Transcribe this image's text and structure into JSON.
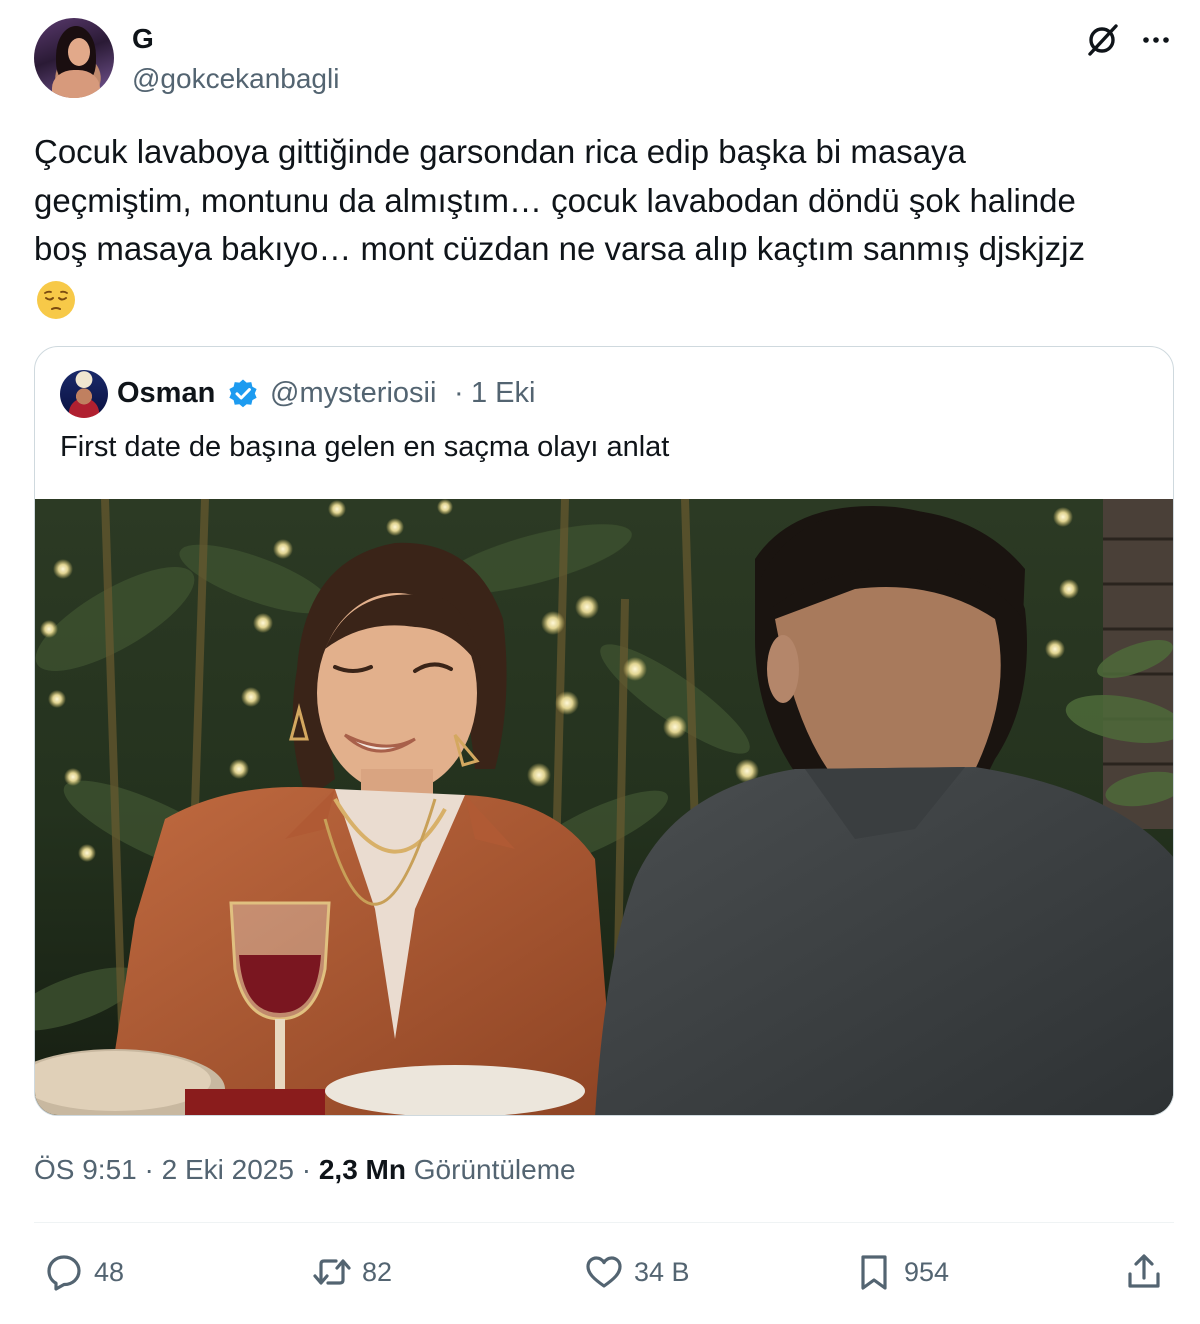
{
  "author": {
    "display_name": "G",
    "handle": "@gokcekanbagli"
  },
  "header_icons": {
    "grok": "grok-icon",
    "more": "more-icon"
  },
  "tweet": {
    "text": "Çocuk lavaboya gittiğinde garsondan rica edip başka bi masaya\ngeçmiştim, montunu da almıştım… çocuk lavabodan döndü şok halinde\nboş masaya bakıyo… mont cüzdan ne varsa alıp kaçtım sanmış djskjzjz",
    "emoji": "😔"
  },
  "quote": {
    "display_name": "Osman",
    "verified_icon": "verified-badge-icon",
    "handle": "@mysteriosii",
    "separator": "·",
    "date": "1 Eki",
    "text": "First date de başına gelen en saçma olayı anlat",
    "media": "image"
  },
  "meta": {
    "time": "ÖS 9:51",
    "sep1": " · ",
    "date": "2 Eki 2025",
    "sep2": " · ",
    "views_count": "2,3 Mn",
    "views_label": " Görüntüleme"
  },
  "actions": {
    "reply_count": "48",
    "retweet_count": "82",
    "like_count": "34 B",
    "bookmark_count": "954"
  },
  "colors": {
    "text": "#0f1419",
    "secondary": "#536471",
    "border": "#cfd9de",
    "verified": "#1d9bf0"
  }
}
